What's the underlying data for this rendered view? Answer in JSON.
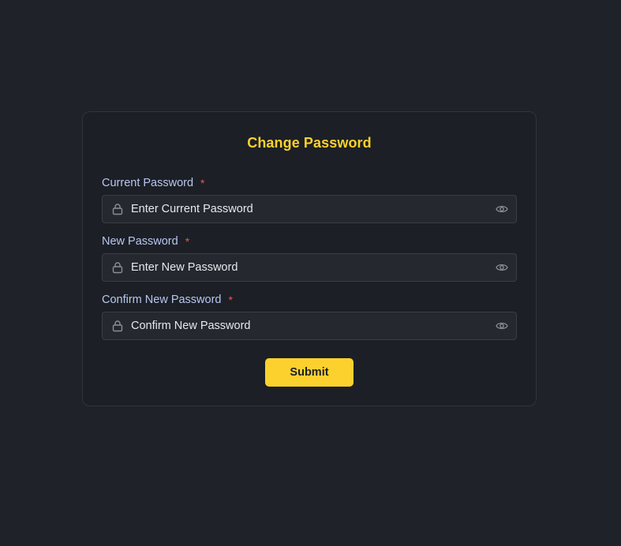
{
  "form": {
    "title": "Change Password",
    "fields": [
      {
        "label": "Current Password",
        "required_mark": "*",
        "placeholder": "Enter Current Password",
        "lock_icon": "lock-icon",
        "toggle_icon": "eye-icon"
      },
      {
        "label": "New Password",
        "required_mark": "*",
        "placeholder": "Enter New Password",
        "lock_icon": "lock-icon",
        "toggle_icon": "eye-icon"
      },
      {
        "label": "Confirm New Password",
        "required_mark": "*",
        "placeholder": "Confirm New Password",
        "lock_icon": "lock-icon",
        "toggle_icon": "eye-icon"
      }
    ],
    "submit_label": "Submit"
  },
  "colors": {
    "background": "#1f2229",
    "card": "#1c1f25",
    "accent": "#fcd12e",
    "label": "#b8c7f0",
    "required": "#f05252",
    "input_bg": "#25282e"
  }
}
